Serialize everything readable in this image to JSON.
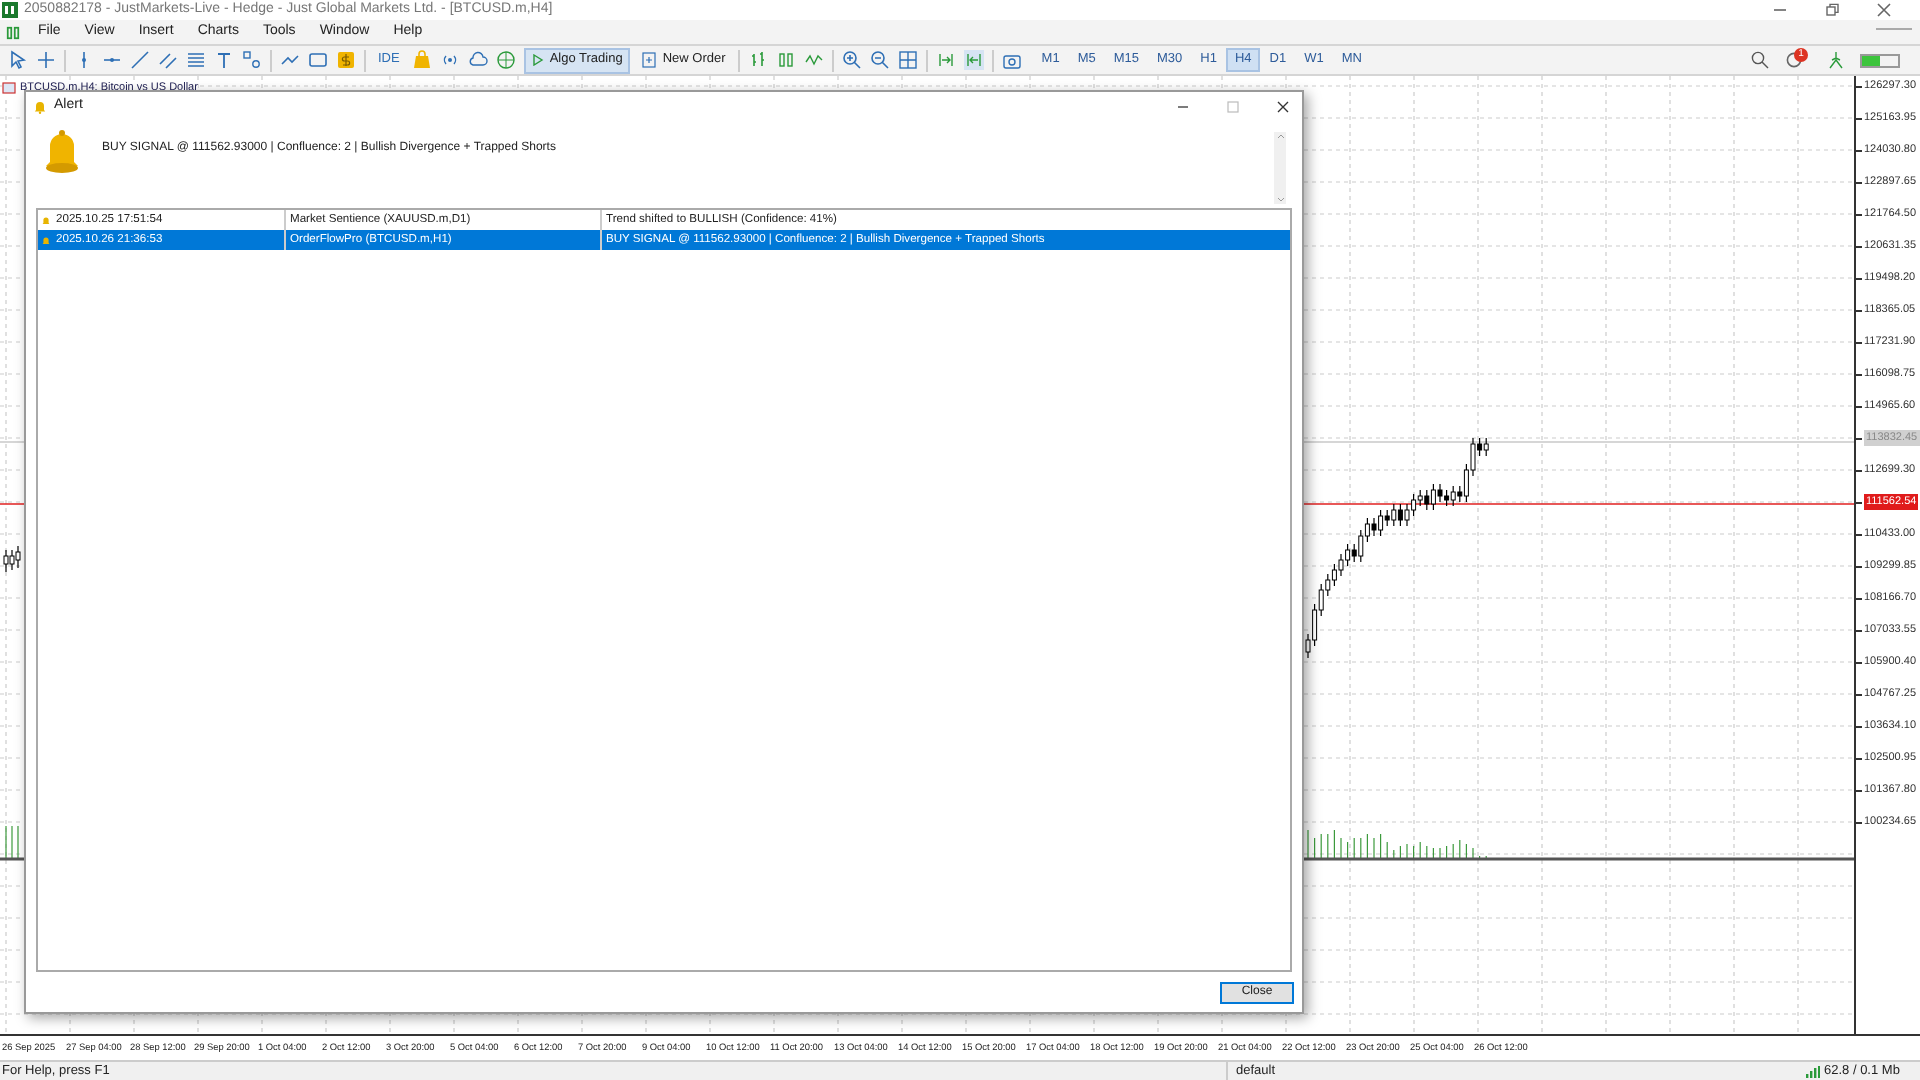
{
  "window": {
    "title": "2050882178 - JustMarkets-Live - Hedge - Just Global Markets Ltd. - [BTCUSD.m,H4]"
  },
  "menu": [
    "File",
    "View",
    "Insert",
    "Charts",
    "Tools",
    "Window",
    "Help"
  ],
  "toolbar": {
    "ide": "IDE",
    "algo_trading": {
      "label": "Algo Trading",
      "on": true
    },
    "new_order": "New Order",
    "timeframes": [
      {
        "label": "M1",
        "selected": false
      },
      {
        "label": "M5",
        "selected": false
      },
      {
        "label": "M15",
        "selected": false
      },
      {
        "label": "M30",
        "selected": false
      },
      {
        "label": "H1",
        "selected": false
      },
      {
        "label": "H4",
        "selected": true
      },
      {
        "label": "D1",
        "selected": false
      },
      {
        "label": "W1",
        "selected": false
      },
      {
        "label": "MN",
        "selected": false
      }
    ],
    "notification_count": "1"
  },
  "chart": {
    "tab": "BTCUSD.m,H4: Bitcoin vs US Dollar",
    "price_labels": [
      {
        "text": "126297.30",
        "kind": "tick"
      },
      {
        "text": "125163.95",
        "kind": "tick"
      },
      {
        "text": "124030.80",
        "kind": "tick"
      },
      {
        "text": "122897.65",
        "kind": "tick"
      },
      {
        "text": "121764.50",
        "kind": "tick"
      },
      {
        "text": "120631.35",
        "kind": "tick"
      },
      {
        "text": "119498.20",
        "kind": "tick"
      },
      {
        "text": "118365.05",
        "kind": "tick"
      },
      {
        "text": "117231.90",
        "kind": "tick"
      },
      {
        "text": "116098.75",
        "kind": "tick"
      },
      {
        "text": "114965.60",
        "kind": "tick"
      },
      {
        "text": "113832.45",
        "kind": "ask"
      },
      {
        "text": "112699.30",
        "kind": "tick"
      },
      {
        "text": "111562.54",
        "kind": "bid"
      },
      {
        "text": "110433.00",
        "kind": "tick"
      },
      {
        "text": "109299.85",
        "kind": "tick"
      },
      {
        "text": "108166.70",
        "kind": "tick"
      },
      {
        "text": "107033.55",
        "kind": "tick"
      },
      {
        "text": "105900.40",
        "kind": "tick"
      },
      {
        "text": "104767.25",
        "kind": "tick"
      },
      {
        "text": "103634.10",
        "kind": "tick"
      },
      {
        "text": "102500.95",
        "kind": "tick"
      },
      {
        "text": "101367.80",
        "kind": "tick"
      },
      {
        "text": "100234.65",
        "kind": "tick"
      }
    ],
    "time_labels": [
      "26 Sep 2025",
      "27 Sep 04:00",
      "28 Sep 12:00",
      "29 Sep 20:00",
      "1 Oct 04:00",
      "2 Oct 12:00",
      "3 Oct 20:00",
      "5 Oct 04:00",
      "6 Oct 12:00",
      "7 Oct 20:00",
      "9 Oct 04:00",
      "10 Oct 12:00",
      "11 Oct 20:00",
      "13 Oct 04:00",
      "14 Oct 12:00",
      "15 Oct 20:00",
      "17 Oct 04:00",
      "18 Oct 12:00",
      "19 Oct 20:00",
      "21 Oct 04:00",
      "22 Oct 12:00",
      "23 Oct 20:00",
      "25 Oct 04:00",
      "26 Oct 12:00"
    ]
  },
  "alert": {
    "title": "Alert",
    "message": "BUY SIGNAL @ 111562.93000 | Confluence: 2 | Bullish Divergence + Trapped Shorts",
    "rows": [
      {
        "time": "2025.10.25 17:51:54",
        "source": "Market Sentience (XAUUSD.m,D1)",
        "text": "Trend shifted to BULLISH (Confidence: 41%)",
        "selected": false
      },
      {
        "time": "2025.10.26 21:36:53",
        "source": "OrderFlowPro (BTCUSD.m,H1)",
        "text": "BUY SIGNAL @ 111562.93000 | Confluence: 2 | Bullish Divergence + Trapped Shorts",
        "selected": true
      }
    ],
    "close_button": "Close"
  },
  "status_bar": {
    "help": "For Help, press F1",
    "profile": "default",
    "traffic": "62.8 / 0.1 Mb"
  }
}
